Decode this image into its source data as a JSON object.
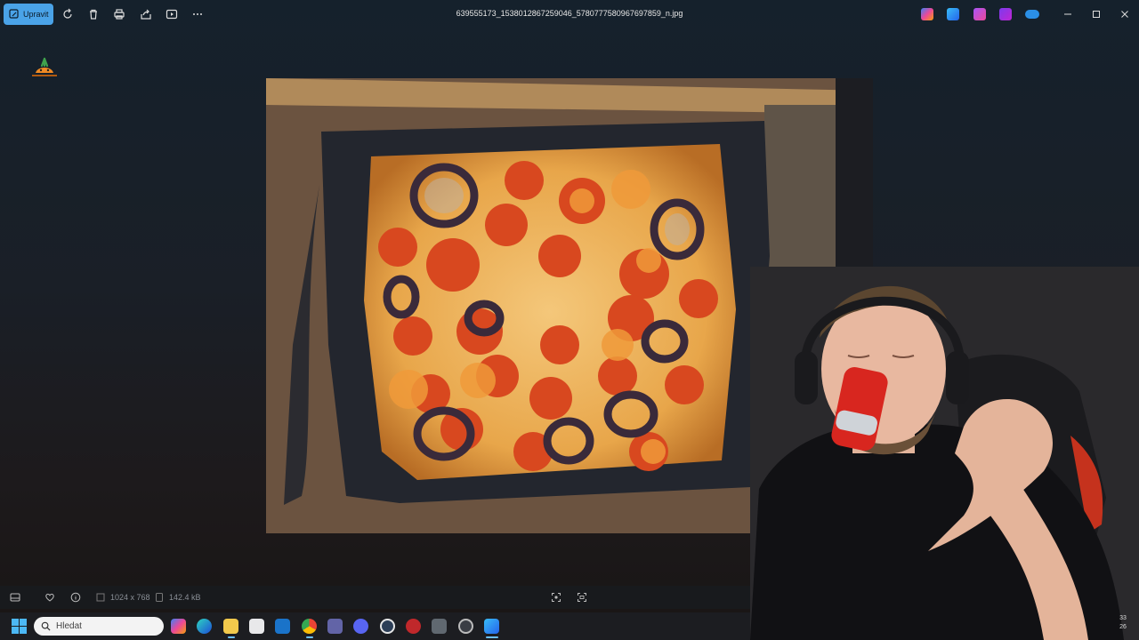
{
  "toolbar": {
    "edit_label": "Upravit",
    "filename": "639555173_1538012867259046_5780777580967697859_n.jpg"
  },
  "infobar": {
    "dimensions": "1024 x 768",
    "filesize": "142.4 kB"
  },
  "taskbar": {
    "search_placeholder": "Hledat"
  },
  "clock": {
    "line1": "33",
    "line2": "26"
  },
  "colors": {
    "accent": "#4aa3e8",
    "background": "#171c22",
    "taskbar": "#1c1d21"
  },
  "icons": {
    "toolbar": [
      "edit-icon",
      "rotate-icon",
      "delete-icon",
      "print-icon",
      "share-icon",
      "slideshow-icon",
      "more-icon"
    ],
    "taskbar": [
      "copilot-icon",
      "edge-icon",
      "file-explorer-icon",
      "store-icon",
      "outlook-icon",
      "chrome-icon",
      "teams-icon",
      "app-icon",
      "wordpress-icon",
      "obs-icon",
      "calculator-icon",
      "app-icon",
      "photos-icon"
    ]
  }
}
